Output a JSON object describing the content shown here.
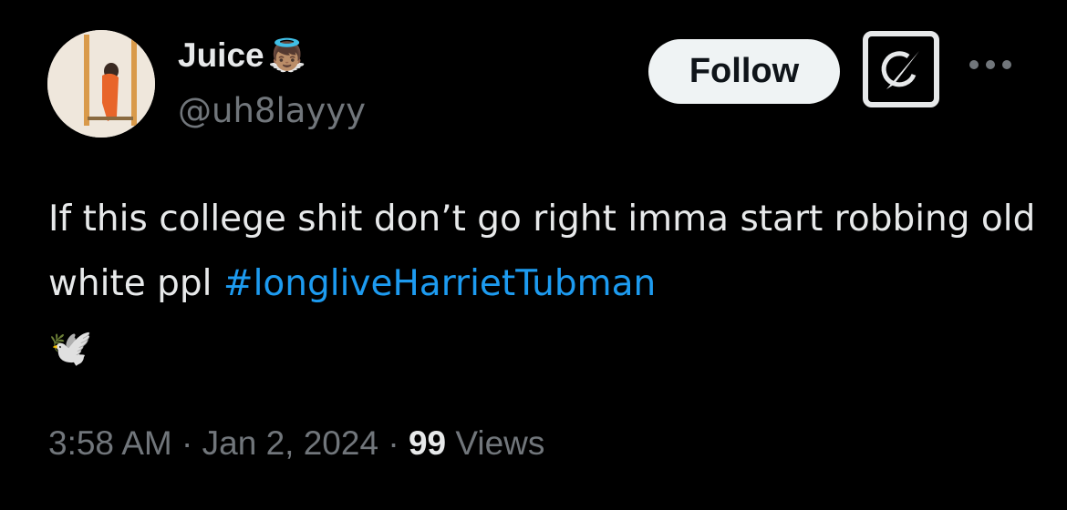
{
  "author": {
    "name": "Juice",
    "name_emoji": "👼🏽",
    "handle": "@uh8layyy"
  },
  "actions": {
    "follow_label": "Follow"
  },
  "tweet": {
    "text": "If this college shit don’t go right imma start robbing old white ppl ",
    "hashtag": "#longliveHarrietTubman",
    "emoji": "🕊️"
  },
  "meta": {
    "time": "3:58 AM",
    "sep1": " · ",
    "date": "Jan 2, 2024",
    "sep2": " · ",
    "views_count": "99",
    "views_label": " Views"
  },
  "colors": {
    "accent": "#1d9bf0",
    "muted": "#71767b",
    "text": "#e7e9ea"
  }
}
